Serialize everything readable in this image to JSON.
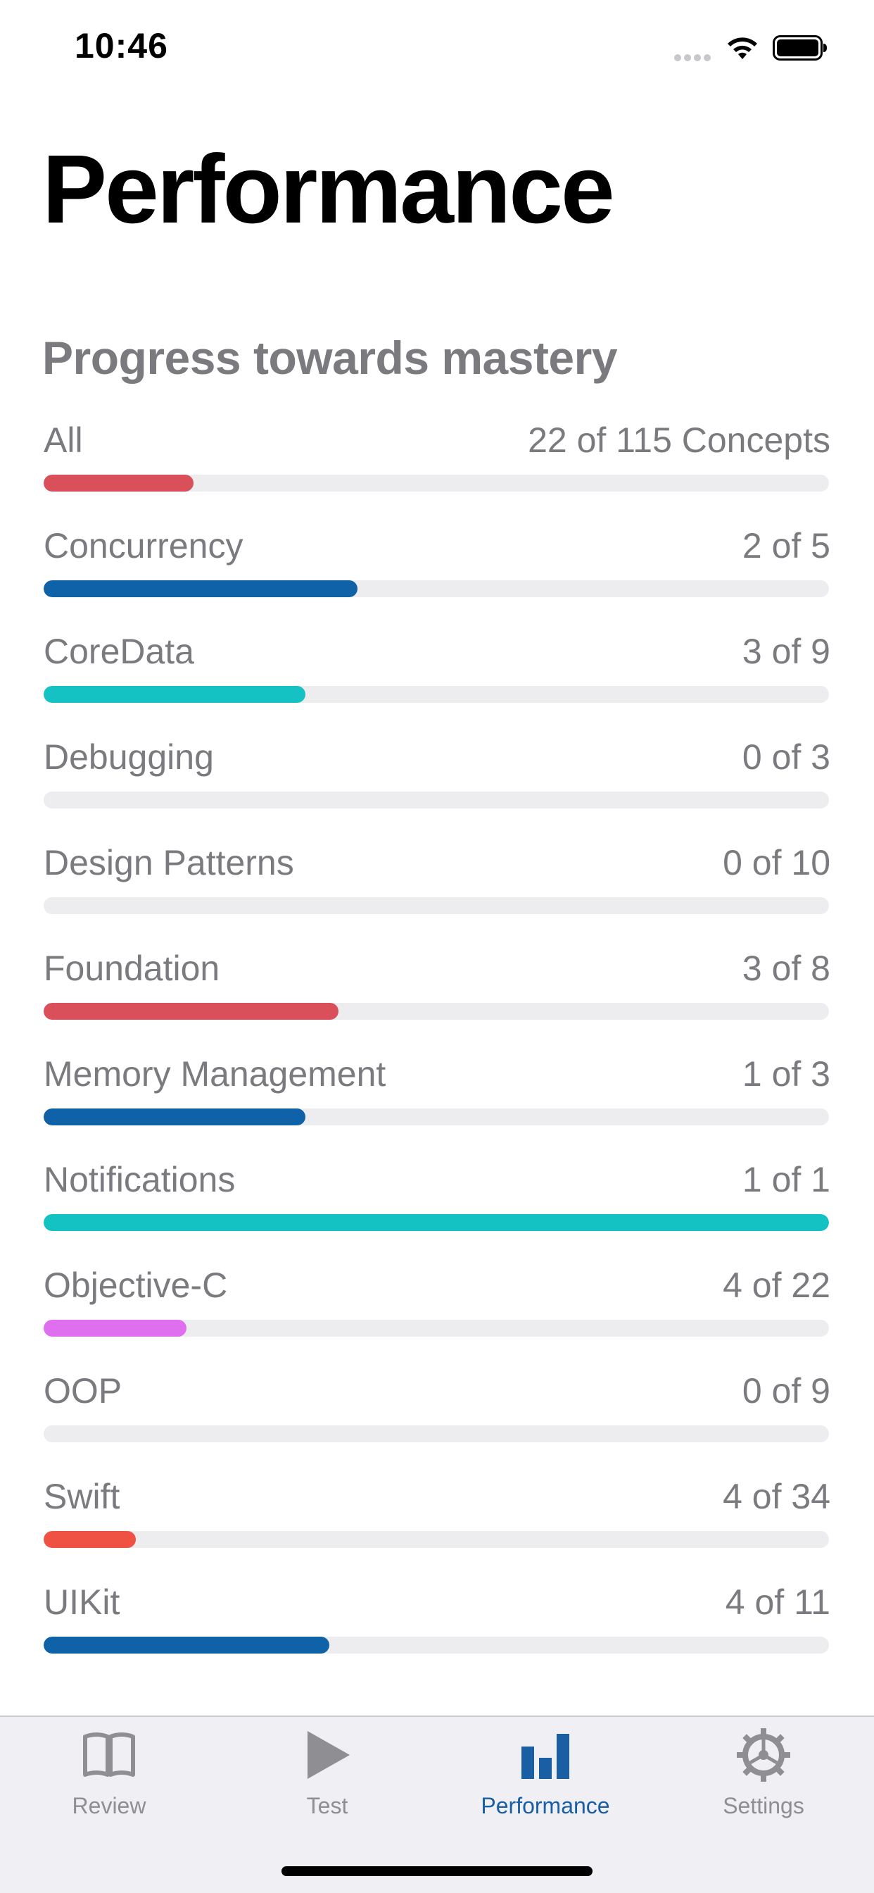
{
  "status_bar": {
    "time": "10:46"
  },
  "header": {
    "title": "Performance",
    "section_title": "Progress towards mastery"
  },
  "progress": [
    {
      "label": "All",
      "count": "22 of 115 Concepts",
      "value": 22,
      "total": 115,
      "color": "#d9505a"
    },
    {
      "label": "Concurrency",
      "count": "2 of 5",
      "value": 2,
      "total": 5,
      "color": "#0f61a8"
    },
    {
      "label": "CoreData",
      "count": "3 of 9",
      "value": 3,
      "total": 9,
      "color": "#14c2c4"
    },
    {
      "label": "Debugging",
      "count": "0 of 3",
      "value": 0,
      "total": 3,
      "color": "#14c2c4"
    },
    {
      "label": "Design Patterns",
      "count": "0 of 10",
      "value": 0,
      "total": 10,
      "color": "#14c2c4"
    },
    {
      "label": "Foundation",
      "count": "3 of 8",
      "value": 3,
      "total": 8,
      "color": "#d9505a"
    },
    {
      "label": "Memory Management",
      "count": "1 of 3",
      "value": 1,
      "total": 3,
      "color": "#0f61a8"
    },
    {
      "label": "Notifications",
      "count": "1 of 1",
      "value": 1,
      "total": 1,
      "color": "#14c2c4"
    },
    {
      "label": "Objective-C",
      "count": "4 of 22",
      "value": 4,
      "total": 22,
      "color": "#e06ff0"
    },
    {
      "label": "OOP",
      "count": "0 of 9",
      "value": 0,
      "total": 9,
      "color": "#e06ff0"
    },
    {
      "label": "Swift",
      "count": "4 of 34",
      "value": 4,
      "total": 34,
      "color": "#ef5242"
    },
    {
      "label": "UIKit",
      "count": "4 of 11",
      "value": 4,
      "total": 11,
      "color": "#0f61a8"
    }
  ],
  "tab_bar": {
    "tabs": [
      {
        "label": "Review",
        "icon": "book-icon",
        "active": false
      },
      {
        "label": "Test",
        "icon": "play-icon",
        "active": false
      },
      {
        "label": "Performance",
        "icon": "bar-chart-icon",
        "active": true
      },
      {
        "label": "Settings",
        "icon": "gear-icon",
        "active": false
      }
    ],
    "inactive_color": "#8e8e93",
    "active_color": "#1a5fa3"
  }
}
